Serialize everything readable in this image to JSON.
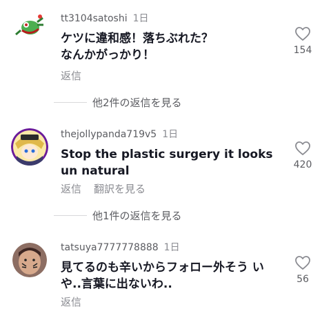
{
  "comments": [
    {
      "username": "tt3104satoshi",
      "time": "1日",
      "text": "ケツに違和感！落ちぶれた？\nなんかがっかり！",
      "reply_label": "返信",
      "likes": "154",
      "view_replies": "他2件の返信を見る"
    },
    {
      "username": "thejollypanda719v5",
      "time": "1日",
      "text": "Stop the plastic surgery it looks un natural",
      "reply_label": "返信",
      "translate_label": "翻訳を見る",
      "likes": "420",
      "view_replies": "他1件の返信を見る"
    },
    {
      "username": "tatsuya7777778888",
      "time": "1日",
      "text": "見てるのも辛いからフォロー外そう いや..言葉に出ないわ..",
      "reply_label": "返信",
      "likes": "56"
    }
  ],
  "colors": {
    "text_primary": "#161823",
    "text_secondary": "#8a8b91",
    "username": "#5b5c61"
  },
  "icons": {
    "like": "heart-outline-icon"
  }
}
